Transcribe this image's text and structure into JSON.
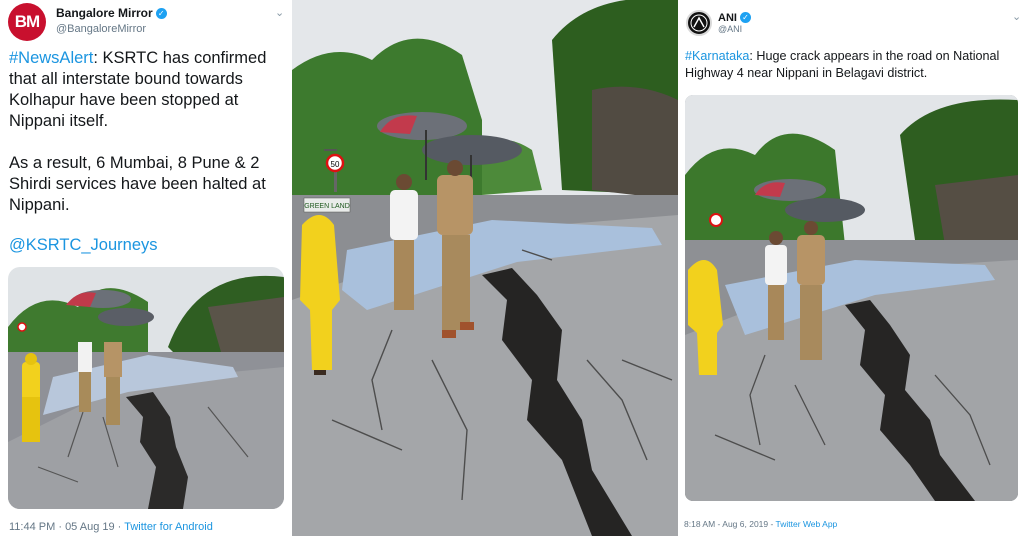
{
  "left_tweet": {
    "display_name": "Bangalore Mirror",
    "handle": "@BangaloreMirror",
    "avatar_text": "BM",
    "hashtag": "#NewsAlert",
    "text_1": ": KSRTC has confirmed that all interstate bound towards Kolhapur have been stopped at Nippani itself.",
    "text_2": "As a result, 6 Mumbai, 8 Pune & 2 Shirdi services have been halted at Nippani.",
    "mention": "@KSRTC_Journeys",
    "time": "11:44 PM",
    "date": "05 Aug 19",
    "source": "Twitter for Android",
    "sign_text": "GREEN LAND"
  },
  "right_tweet": {
    "display_name": "ANI",
    "handle": "@ANI",
    "hashtag": "#Karnataka",
    "text": ": Huge crack appears in the road on National Highway 4 near Nippani in Belagavi district.",
    "time": "8:18 AM",
    "date": "Aug 6, 2019",
    "source": "Twitter Web App"
  },
  "middle_photo": {
    "sign_text": "GREEN LAND",
    "speed_sign": "50"
  },
  "colors": {
    "link": "#1b95e0",
    "verified": "#1da1f2",
    "bm_brand": "#c8102e",
    "raincoat": "#f2d11d",
    "tarp": "#9fb8d8"
  }
}
